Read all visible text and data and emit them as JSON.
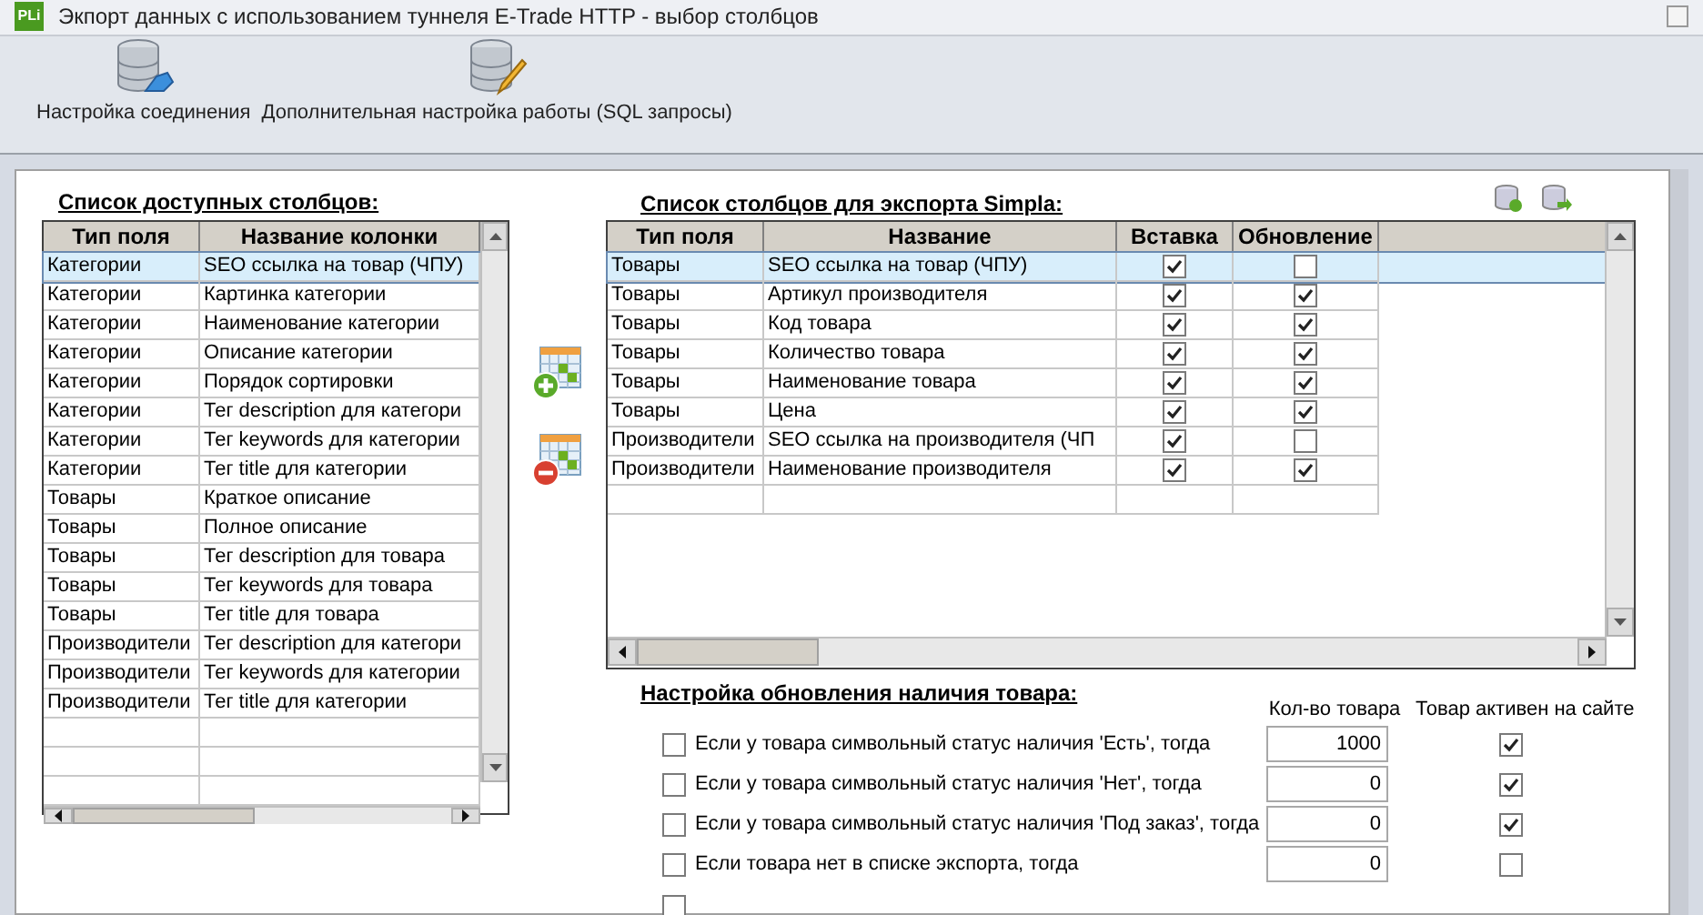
{
  "window": {
    "logo": "PLi",
    "title": "Экпорт данных с использованием туннеля E-Trade HTTP - выбор столбцов"
  },
  "toolbar": {
    "buttons": [
      {
        "label": "Настройка соединения",
        "kind": "connect"
      },
      {
        "label": "Дополнительная настройка работы (SQL запросы)",
        "kind": "edit"
      }
    ]
  },
  "available_columns": {
    "title": "Список доступных столбцов:",
    "columns": [
      "Тип поля",
      "Название колонки"
    ],
    "rows": [
      {
        "field_type": "Категории",
        "name": "SEO ссылка на товар (ЧПУ)",
        "selected": true
      },
      {
        "field_type": "Категории",
        "name": "Картинка категории",
        "selected": false
      },
      {
        "field_type": "Категории",
        "name": "Наименование категории",
        "selected": false
      },
      {
        "field_type": "Категории",
        "name": "Описание категории",
        "selected": false
      },
      {
        "field_type": "Категории",
        "name": "Порядок сортировки",
        "selected": false
      },
      {
        "field_type": "Категории",
        "name": "Тег description для категори",
        "selected": false
      },
      {
        "field_type": "Категории",
        "name": "Тег keywords для категории",
        "selected": false
      },
      {
        "field_type": "Категории",
        "name": "Тег title для категории",
        "selected": false
      },
      {
        "field_type": "Товары",
        "name": "Краткое описание",
        "selected": false
      },
      {
        "field_type": "Товары",
        "name": "Полное описание",
        "selected": false
      },
      {
        "field_type": "Товары",
        "name": "Тег description для товара",
        "selected": false
      },
      {
        "field_type": "Товары",
        "name": "Тег keywords для товара",
        "selected": false
      },
      {
        "field_type": "Товары",
        "name": "Тег title для товара",
        "selected": false
      },
      {
        "field_type": "Производители",
        "name": "Тег description для категори",
        "selected": false
      },
      {
        "field_type": "Производители",
        "name": "Тег keywords для категории",
        "selected": false
      },
      {
        "field_type": "Производители",
        "name": "Тег title для категории",
        "selected": false
      }
    ]
  },
  "export_columns": {
    "title": "Список столбцов для экспорта Simpla:",
    "columns": [
      "Тип поля",
      "Название",
      "Вставка",
      "Обновление"
    ],
    "rows": [
      {
        "field_type": "Товары",
        "name": "SEO ссылка на товар (ЧПУ)",
        "insert": true,
        "update": false,
        "selected": true
      },
      {
        "field_type": "Товары",
        "name": "Артикул производителя",
        "insert": true,
        "update": true,
        "selected": false
      },
      {
        "field_type": "Товары",
        "name": "Код товара",
        "insert": true,
        "update": true,
        "selected": false
      },
      {
        "field_type": "Товары",
        "name": "Количество товара",
        "insert": true,
        "update": true,
        "selected": false
      },
      {
        "field_type": "Товары",
        "name": "Наименование товара",
        "insert": true,
        "update": true,
        "selected": false
      },
      {
        "field_type": "Товары",
        "name": "Цена",
        "insert": true,
        "update": true,
        "selected": false
      },
      {
        "field_type": "Производители",
        "name": "SEO ссылка на производителя (ЧП",
        "insert": true,
        "update": false,
        "selected": false
      },
      {
        "field_type": "Производители",
        "name": "Наименование производителя",
        "insert": true,
        "update": true,
        "selected": false
      }
    ]
  },
  "stock_settings": {
    "title": "Настройка обновления наличия товара:",
    "columns": [
      "Кол-во товара",
      "Товар активен на сайте"
    ],
    "rows": [
      {
        "label": "Если у товара символьный статус наличия 'Есть', тогда",
        "checked": false,
        "quantity": "1000",
        "active": true
      },
      {
        "label": "Если у товара символьный статус наличия 'Нет', тогда",
        "checked": false,
        "quantity": "0",
        "active": true
      },
      {
        "label": "Если у товара символьный статус наличия 'Под заказ', тогда",
        "checked": false,
        "quantity": "0",
        "active": true
      },
      {
        "label": "Если товара нет в списке экспорта, тогда",
        "checked": false,
        "quantity": "0",
        "active": false
      }
    ],
    "extra_option": {
      "checked": false
    }
  }
}
